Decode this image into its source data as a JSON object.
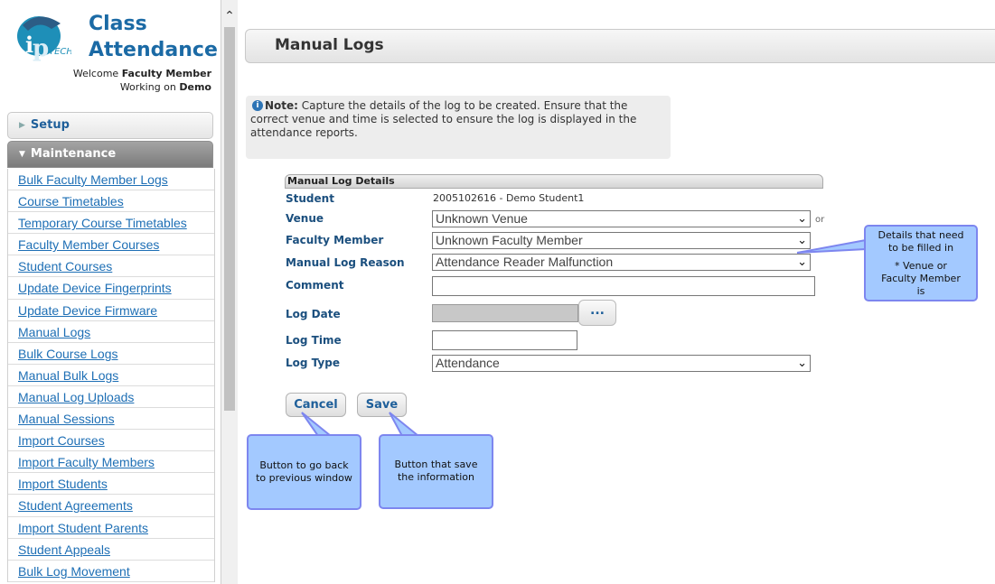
{
  "app": {
    "title_line1": "Class",
    "title_line2": "Attendance",
    "logo_text": "TECH",
    "welcome_prefix": "Welcome ",
    "user": "Faculty Member",
    "working_prefix": "Working on ",
    "workspace": "Demo"
  },
  "sidebar": {
    "setup_label": "Setup",
    "maintenance_label": "Maintenance",
    "items": [
      "Bulk Faculty Member Logs",
      "Course Timetables",
      "Temporary Course Timetables",
      "Faculty Member Courses",
      "Student Courses",
      "Update Device Fingerprints",
      "Update Device Firmware",
      "Manual Logs",
      "Bulk Course Logs",
      "Manual Bulk Logs",
      "Manual Log Uploads",
      "Manual Sessions",
      "Import Courses",
      "Import Faculty Members",
      "Import Students",
      "Student Agreements",
      "Import Student Parents",
      "Student Appeals",
      "Bulk Log Movement"
    ]
  },
  "page": {
    "title": "Manual Logs",
    "note_label": "Note:",
    "note_text": " Capture the details of the log to be created. Ensure that the correct venue and time is selected to ensure the log is displayed in the attendance reports."
  },
  "form": {
    "header": "Manual Log Details",
    "student_label": "Student",
    "student_value": "2005102616 - Demo Student1",
    "venue_label": "Venue",
    "venue_value": "Unknown Venue",
    "or_text": "or",
    "faculty_label": "Faculty Member",
    "faculty_value": "Unknown Faculty Member",
    "reason_label": "Manual Log Reason",
    "reason_value": "Attendance Reader Malfunction",
    "comment_label": "Comment",
    "comment_value": "",
    "log_date_label": "Log Date",
    "date_button": "...",
    "log_time_label": "Log Time",
    "log_time_value": "",
    "log_type_label": "Log Type",
    "log_type_value": "Attendance",
    "cancel_label": "Cancel",
    "save_label": "Save"
  },
  "callouts": {
    "details_line1": "Details that need to be filled in",
    "details_line2": "* Venue or Faculty Member is",
    "cancel_note": "Button to go back to previous window",
    "save_note": "Button that save the information"
  },
  "colors": {
    "link": "#1e6fb5",
    "label": "#1b4f7e",
    "callout_bg": "#a3c9ff",
    "callout_border": "#7d86ef"
  }
}
